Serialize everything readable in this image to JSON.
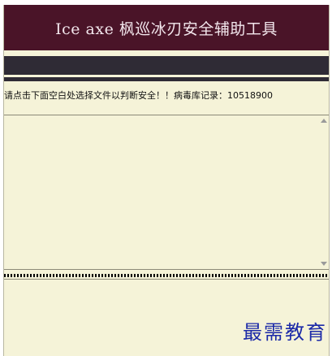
{
  "window": {
    "title": "Ice axe 枫巡冰刃安全辅助工具"
  },
  "status": {
    "instruction": "请点击下面空白处选择文件以判断安全！！",
    "db_label": "病毒库记录：",
    "db_count": "10518900"
  },
  "watermark": {
    "text": "最需教育"
  },
  "colors": {
    "titlebar": "#4a1428",
    "toolbar": "#2f2b35",
    "background": "#f5f3d8",
    "watermark": "#1c2aa8"
  }
}
